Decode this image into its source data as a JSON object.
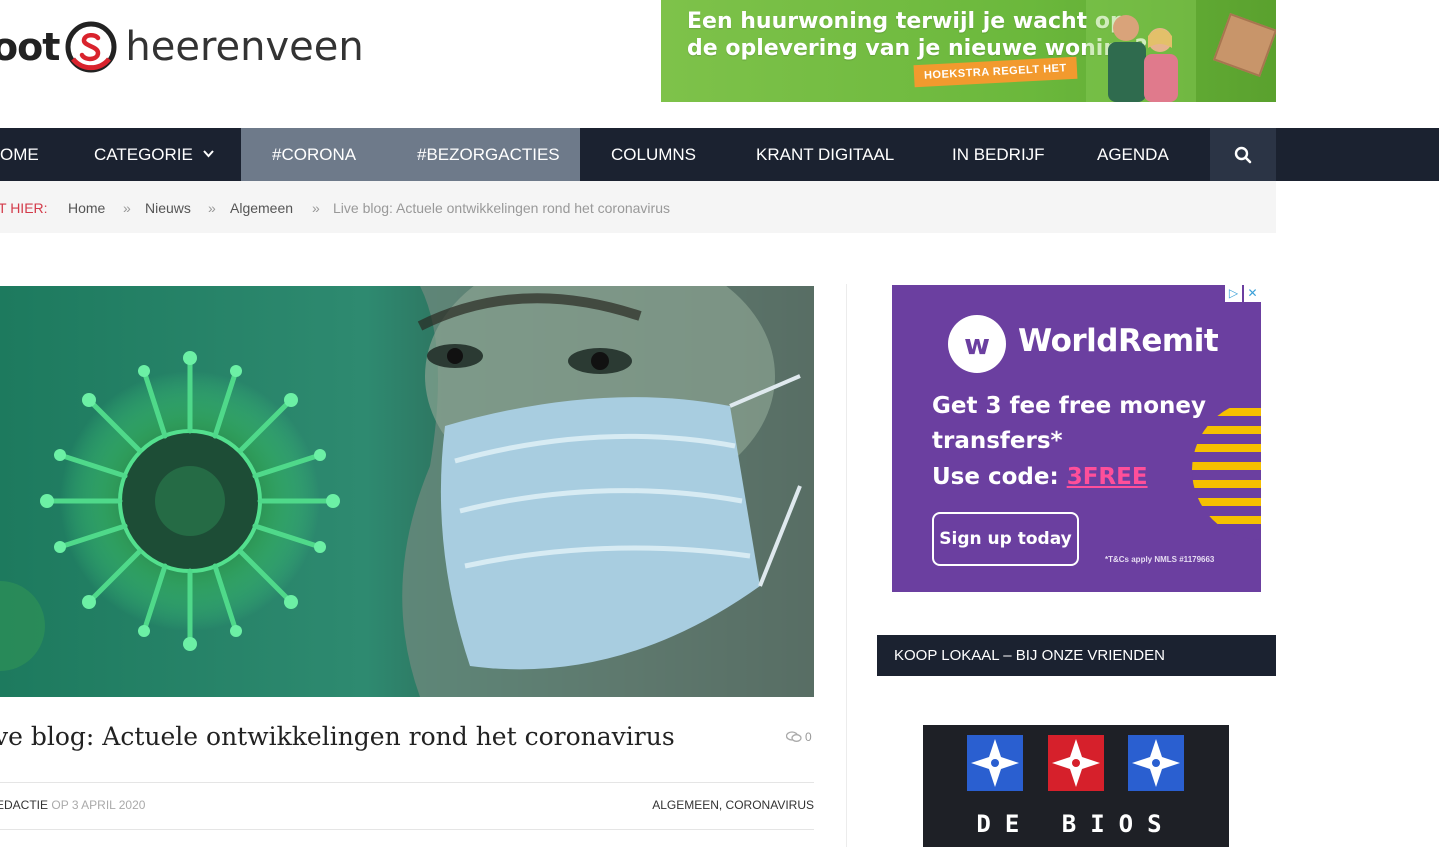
{
  "header": {
    "logo_left": "oot",
    "logo_right": "heerenveen",
    "top_ad": {
      "line1": "Een huurwoning terwijl je wacht op",
      "line2": "de oplevering van je nieuwe woning?",
      "tag": "HOEKSTRA REGELT HET"
    }
  },
  "nav": {
    "items": [
      "OME",
      "CATEGORIE",
      "#CORONA",
      "#BEZORGACTIES",
      "COLUMNS",
      "KRANT DIGITAAL",
      "IN BEDRIJF",
      "AGENDA"
    ],
    "search_icon": "search-icon"
  },
  "breadcrumb": {
    "label": "T HIER:",
    "items": [
      "Home",
      "Nieuws",
      "Algemeen",
      "Live blog: Actuele ontwikkelingen rond het coronavirus"
    ],
    "separator": "»"
  },
  "article": {
    "title": "ive blog: Actuele ontwikkelingen rond het coronavirus",
    "comment_count": "0",
    "author": "EDACTIE",
    "date": "OP 3 APRIL 2020",
    "categories": "ALGEMEEN, CORONAVIRUS"
  },
  "sidebar": {
    "ad": {
      "brand": "WorldRemit",
      "line1": "Get 3 fee free money",
      "line2": "transfers*",
      "line3_prefix": "Use code: ",
      "code": "3FREE",
      "button": "Sign up today",
      "terms": "*T&Cs apply  NMLS #1179663",
      "adchoices": "▷",
      "close": "✕"
    },
    "widget_title": "KOOP LOKAAL – BIJ ONZE VRIENDEN",
    "bios_word": "DE BIOS"
  },
  "colors": {
    "nav_bg": "#1b2230",
    "nav_highlight": "#6e7a8a",
    "breadcrumb_here": "#d33b4a",
    "logo_red": "#d9232d",
    "ad_purple": "#6b3fa0",
    "ad_green": "#6bb83c"
  }
}
